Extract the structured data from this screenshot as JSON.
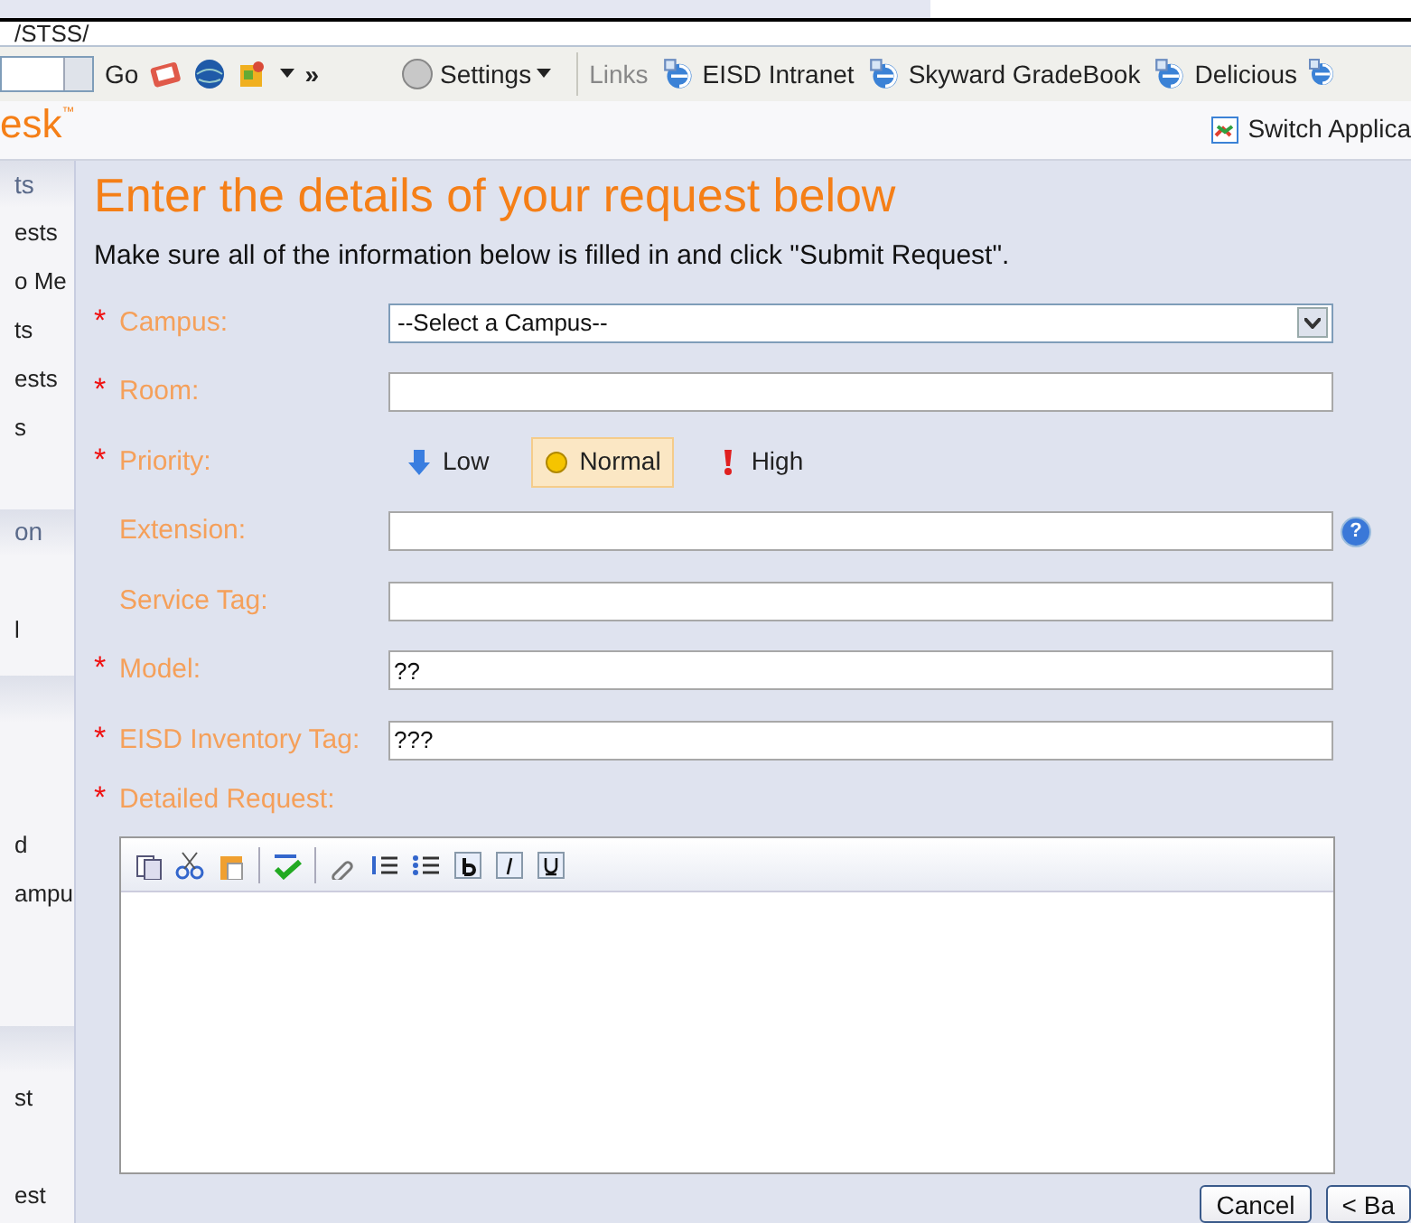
{
  "address_bar": {
    "text": "/STSS/"
  },
  "browser_toolbar": {
    "go_label": "Go",
    "more": "»",
    "settings": "Settings",
    "links_label": "Links",
    "links": [
      "EISD Intranet",
      "Skyward GradeBook",
      "Delicious"
    ]
  },
  "app_header": {
    "logo": "esk",
    "logo_mark": "™",
    "switch_app": "Switch Applica"
  },
  "sidebar": {
    "sections": [
      {
        "header": "ts",
        "items": [
          "ests",
          "o Me",
          "ts",
          "ests",
          "s"
        ]
      },
      {
        "header": "on",
        "items": [
          "l"
        ]
      },
      {
        "items": [
          "d",
          "ampu"
        ]
      },
      {
        "items": [
          "st",
          "est"
        ]
      }
    ]
  },
  "form": {
    "title": "Enter the details of your request below",
    "instructions": "Make sure all of the information below is filled in and click \"Submit Request\".",
    "fields": [
      {
        "kind": "select",
        "label": "Campus:",
        "required_mark": "*",
        "value": "--Select a Campus--"
      },
      {
        "kind": "text",
        "label": "Room:",
        "required_mark": "*"
      },
      {
        "kind": "priority",
        "label": "Priority:",
        "required_mark": "*",
        "options": [
          {
            "label": "Low",
            "selected": false
          },
          {
            "label": "Normal",
            "selected": true
          },
          {
            "label": "High",
            "selected": false
          }
        ]
      },
      {
        "kind": "text",
        "label": "Extension:",
        "help": "?"
      },
      {
        "kind": "text",
        "label": "Service Tag:"
      },
      {
        "kind": "text",
        "label": "Model:",
        "required_mark": "*",
        "value": "??"
      },
      {
        "kind": "text",
        "label": "EISD Inventory Tag:",
        "required_mark": "*",
        "value": "???"
      },
      {
        "kind": "editor",
        "label": "Detailed Request:",
        "required_mark": "*"
      }
    ],
    "buttons": [
      "Cancel",
      "< Ba"
    ]
  }
}
